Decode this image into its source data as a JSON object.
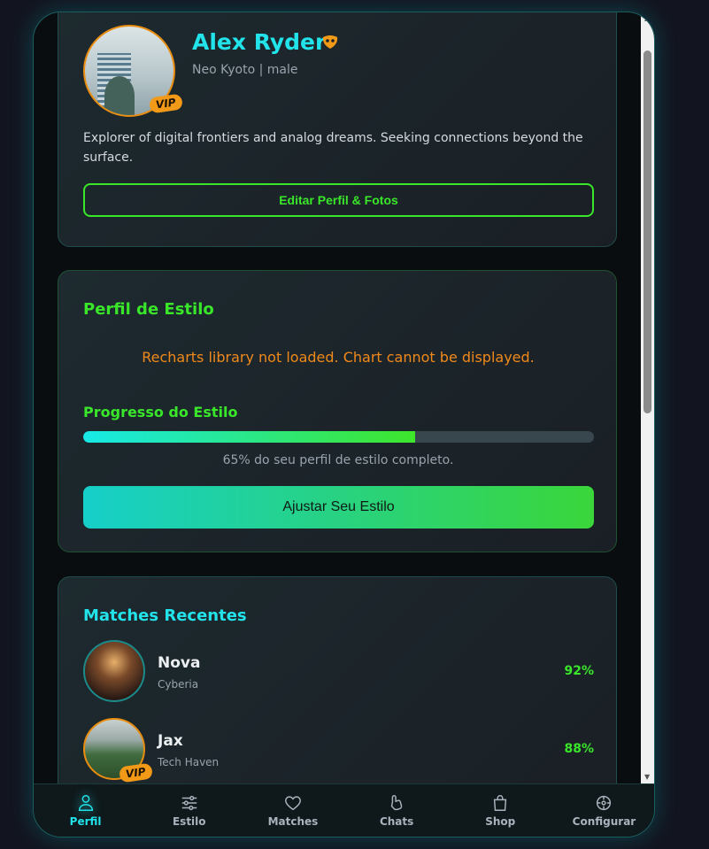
{
  "profile": {
    "name": "Alex Ryder",
    "location": "Neo Kyoto | male",
    "vip_label": "VIP",
    "bio": "Explorer of digital frontiers and analog dreams. Seeking connections beyond the surface.",
    "edit_button": "Editar Perfil & Fotos"
  },
  "style_profile": {
    "title": "Perfil de Estilo",
    "chart_error": "Recharts library not loaded. Chart cannot be displayed.",
    "progress_title": "Progresso do Estilo",
    "progress_percent": 65,
    "progress_text": "65% do seu perfil de estilo completo.",
    "adjust_button": "Ajustar Seu Estilo"
  },
  "matches": {
    "title": "Matches Recentes",
    "items": [
      {
        "name": "Nova",
        "location": "Cyberia",
        "score": "92%",
        "vip": false
      },
      {
        "name": "Jax",
        "location": "Tech Haven",
        "score": "88%",
        "vip": true,
        "vip_label": "VIP"
      }
    ]
  },
  "nav": {
    "items": [
      {
        "label": "Perfil",
        "icon": "user-icon",
        "active": true
      },
      {
        "label": "Estilo",
        "icon": "sliders-icon",
        "active": false
      },
      {
        "label": "Matches",
        "icon": "heart-icon",
        "active": false
      },
      {
        "label": "Chats",
        "icon": "chat-icon",
        "active": false
      },
      {
        "label": "Shop",
        "icon": "shopping-bag-icon",
        "active": false
      },
      {
        "label": "Configurar",
        "icon": "settings-icon",
        "active": false
      }
    ]
  },
  "colors": {
    "accent_cyan": "#22e3ea",
    "accent_green": "#39e629",
    "accent_orange": "#f29a18"
  }
}
